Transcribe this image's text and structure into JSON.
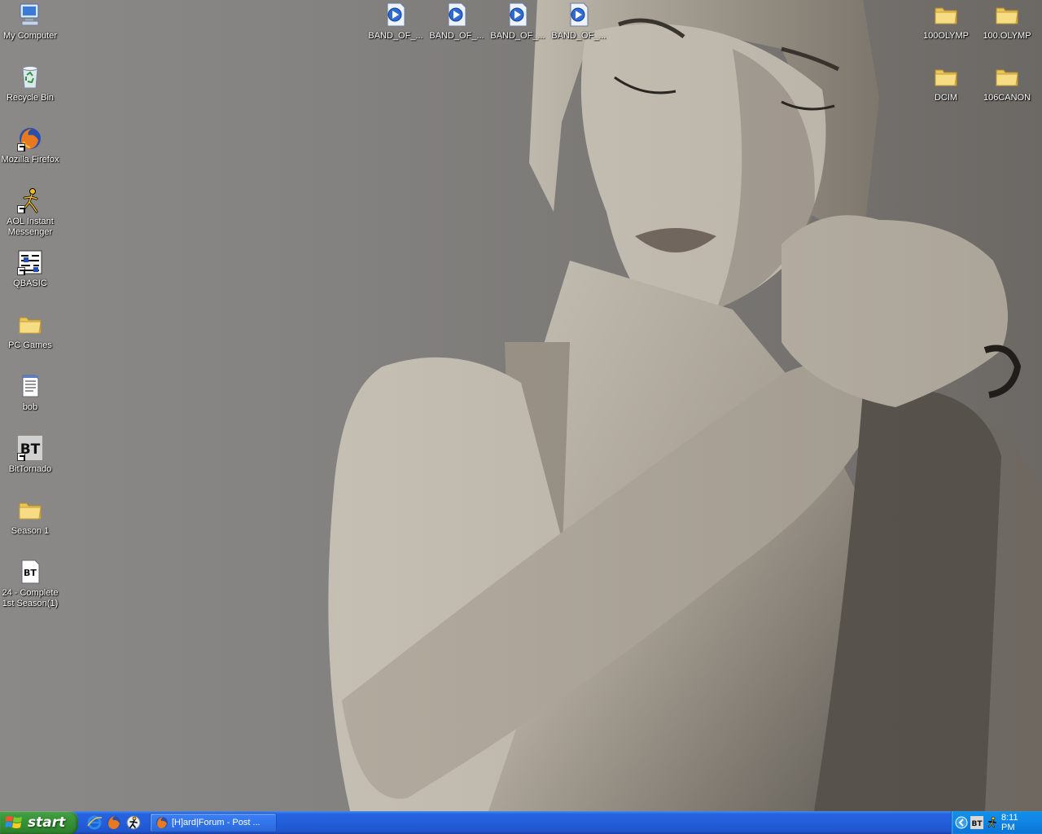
{
  "desktop": {
    "left_icons": [
      {
        "label": "My Computer",
        "icon": "my-computer-icon"
      },
      {
        "label": "Recycle Bin",
        "icon": "recycle-bin-icon"
      },
      {
        "label": "Mozilla Firefox",
        "icon": "firefox-icon"
      },
      {
        "label": "AOL Instant\nMessenger",
        "icon": "aim-icon"
      },
      {
        "label": "QBASIC",
        "icon": "qbasic-icon"
      },
      {
        "label": "PC Games",
        "icon": "folder-icon"
      },
      {
        "label": "bob",
        "icon": "text-document-icon"
      },
      {
        "label": "BitTornado",
        "icon": "bittornado-icon"
      },
      {
        "label": "Season 1",
        "icon": "folder-icon"
      },
      {
        "label": "24 - Complete\n1st Season(1)",
        "icon": "torrent-file-icon"
      }
    ],
    "top_icons": [
      {
        "label": "BAND_OF_...",
        "icon": "media-file-icon"
      },
      {
        "label": "BAND_OF_...",
        "icon": "media-file-icon"
      },
      {
        "label": "BAND_OF_...",
        "icon": "media-file-icon"
      },
      {
        "label": "BAND_OF_...",
        "icon": "media-file-icon"
      }
    ],
    "right_icons": [
      {
        "label": "100OLYMP",
        "icon": "folder-icon"
      },
      {
        "label": "100.OLYMP",
        "icon": "folder-icon"
      },
      {
        "label": "DCIM",
        "icon": "folder-icon"
      },
      {
        "label": "106CANON",
        "icon": "folder-icon"
      }
    ]
  },
  "taskbar": {
    "start_label": "start",
    "quick_launch": [
      "internet-explorer-icon",
      "firefox-icon",
      "aim-icon"
    ],
    "tasks": [
      {
        "label": "[H]ard|Forum - Post ...",
        "icon": "firefox-icon"
      }
    ],
    "tray_icons": [
      "show-hidden-icons-chevron-icon",
      "bittornado-tray-icon",
      "aim-tray-icon"
    ],
    "clock": "8:11 PM"
  },
  "colors": {
    "taskbar_blue": "#245edb",
    "start_green": "#338e33",
    "tray_blue": "#0f84e4",
    "wallpaper_gray": "#8a8886"
  }
}
